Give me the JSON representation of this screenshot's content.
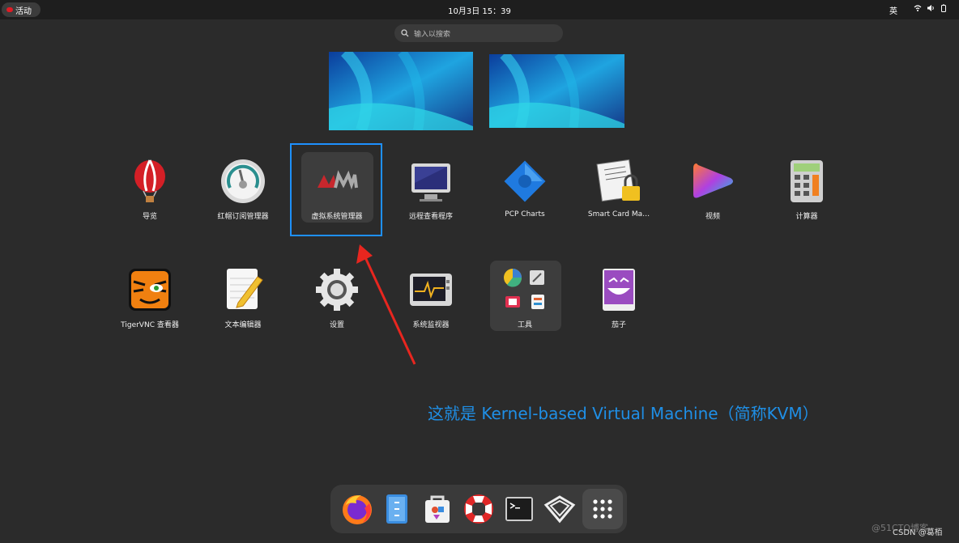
{
  "topbar": {
    "activities": "活动",
    "clock": "10月3日  15：39",
    "ime": "英"
  },
  "search": {
    "placeholder": "输入以搜索"
  },
  "apps": [
    {
      "label": "导览",
      "icon": "hot-air-balloon-icon"
    },
    {
      "label": "红帽订阅管理器",
      "icon": "gauge-icon"
    },
    {
      "label": "虚拟系统管理器",
      "icon": "vmm-logo-icon"
    },
    {
      "label": "远程查看程序",
      "icon": "monitor-icon"
    },
    {
      "label": "PCP Charts",
      "icon": "pcp-gear-icon"
    },
    {
      "label": "Smart Card Ma…",
      "icon": "certificate-lock-icon"
    },
    {
      "label": "视频",
      "icon": "video-play-icon"
    },
    {
      "label": "计算器",
      "icon": "calculator-icon"
    },
    {
      "label": "TigerVNC 查看器",
      "icon": "tiger-icon"
    },
    {
      "label": "文本编辑器",
      "icon": "notepad-pencil-icon"
    },
    {
      "label": "设置",
      "icon": "gear-icon"
    },
    {
      "label": "系统监视器",
      "icon": "system-monitor-icon"
    },
    {
      "label": "工具",
      "icon": "folder-grid-icon"
    },
    {
      "label": "茄子",
      "icon": "cheese-icon"
    }
  ],
  "annotation": "这就是 Kernel-based Virtual Machine（简称KVM）",
  "dock": [
    "firefox-icon",
    "files-icon",
    "software-icon",
    "help-lifebuoy-icon",
    "terminal-icon",
    "vm-cube-icon",
    "app-grid-icon"
  ],
  "watermark": "@51CTO博客",
  "csdn": "CSDN @葛栢",
  "colors": {
    "accent": "#1e90ff",
    "annotation": "#1f8fe6",
    "arrow": "#e8261f"
  }
}
